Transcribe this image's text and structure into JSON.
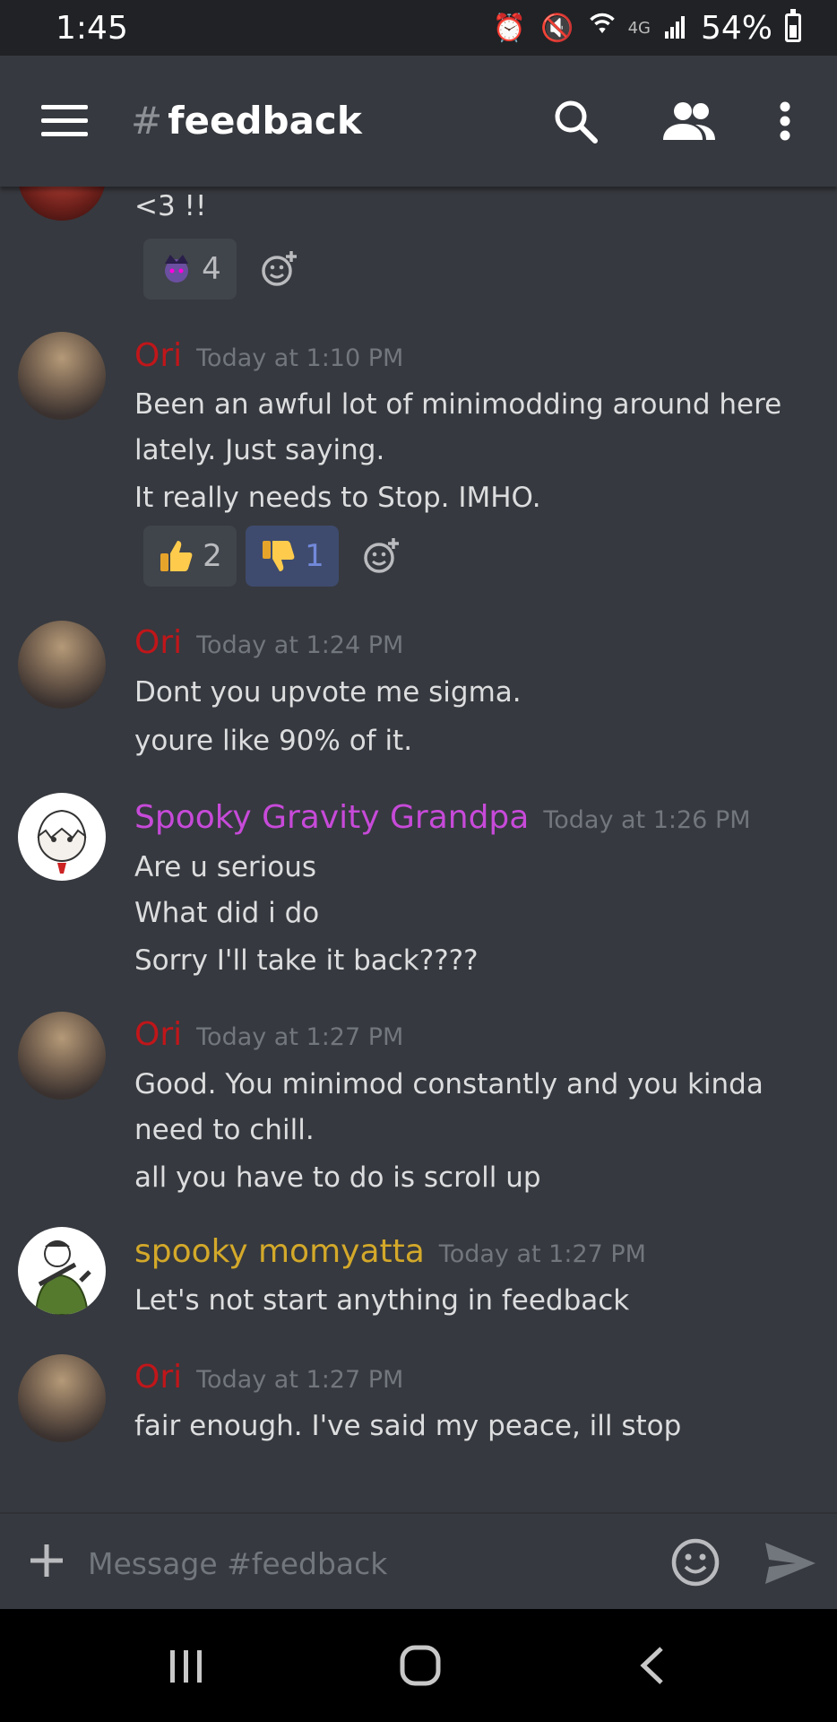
{
  "status_bar": {
    "time": "1:45",
    "network": "4G",
    "battery": "54%",
    "battery_level": 0.54
  },
  "header": {
    "hash": "#",
    "channel": "feedback"
  },
  "top_message": {
    "text": "<3 !!",
    "reaction": {
      "icon": "character-emoji",
      "count": "4"
    }
  },
  "messages": [
    {
      "author": "Ori",
      "author_color": "#c0161a",
      "time": "Today at 1:10 PM",
      "lines": [
        "Been an awful lot of minimodding around here",
        "lately.  Just saying.",
        "It really needs to Stop.  IMHO."
      ],
      "reactions": [
        {
          "icon": "thumbs-up-emoji",
          "count": "2",
          "active": false
        },
        {
          "icon": "thumbs-down-emoji",
          "count": "1",
          "active": true
        }
      ]
    },
    {
      "author": "Ori",
      "author_color": "#c0161a",
      "time": "Today at 1:24 PM",
      "lines": [
        "Dont you upvote me sigma.",
        "youre like 90% of it."
      ]
    },
    {
      "author": "Spooky Gravity Grandpa",
      "author_color": "#c74ad9",
      "time": "Today at 1:26 PM",
      "lines": [
        "Are u serious",
        "What did i do",
        "Sorry I'll take it back????"
      ]
    },
    {
      "author": "Ori",
      "author_color": "#c0161a",
      "time": "Today at 1:27 PM",
      "lines": [
        "Good.  You minimod constantly and you kinda",
        "need to chill.",
        "all you have to do is scroll up"
      ]
    },
    {
      "author": "spooky momyatta",
      "author_color": "#d4a92a",
      "time": "Today at 1:27 PM",
      "lines": [
        "Let's not start anything in feedback"
      ]
    },
    {
      "author": "Ori",
      "author_color": "#c0161a",
      "time": "Today at 1:27 PM",
      "lines": [
        "fair enough.  I've said my peace, ill stop"
      ]
    }
  ],
  "composer": {
    "placeholder": "Message #feedback"
  },
  "colors": {
    "background": "#36393f",
    "header_bg": "#202225",
    "accent": "#7289da"
  }
}
